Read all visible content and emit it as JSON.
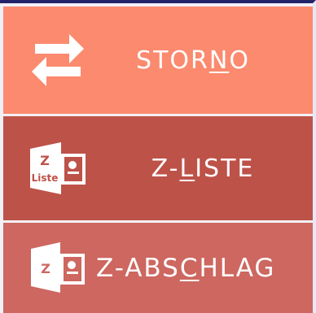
{
  "menu": {
    "items": [
      {
        "id": "storno",
        "label_pre": "STOR",
        "label_mnemonic": "N",
        "label_post": "O",
        "icon": "swap-arrows-icon",
        "color": "#fb8a6f"
      },
      {
        "id": "z-liste",
        "label_pre": "Z-",
        "label_mnemonic": "L",
        "label_post": "ISTE",
        "icon": "z-liste-report-icon",
        "icon_text_top": "Z",
        "icon_text_bottom": "Liste",
        "color": "#bd5249"
      },
      {
        "id": "z-abschlag",
        "label_pre": "Z-ABS",
        "label_mnemonic": "C",
        "label_post": "HLAG",
        "icon": "z-report-icon",
        "icon_text_top": "Z",
        "color": "#cd6760"
      }
    ]
  }
}
